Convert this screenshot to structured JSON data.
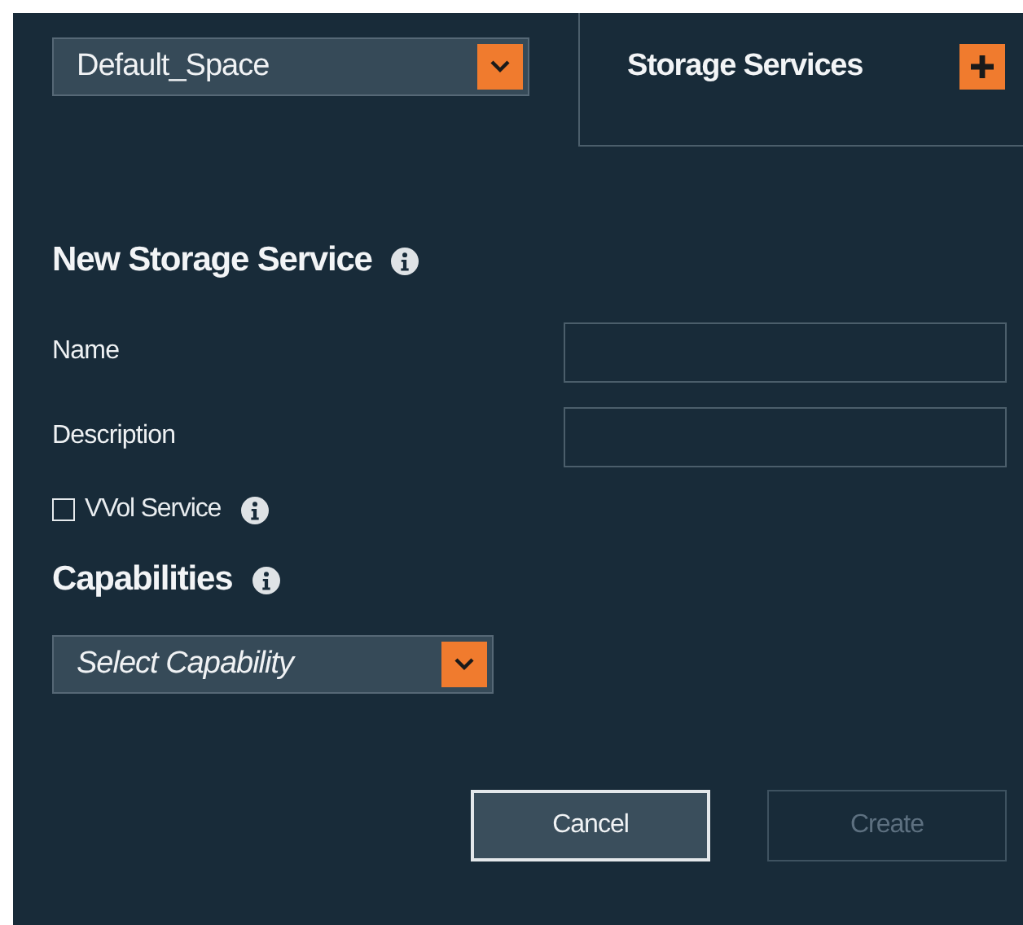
{
  "space_select": {
    "value": "Default_Space"
  },
  "tab": {
    "label": "Storage Services"
  },
  "form": {
    "title": "New Storage Service",
    "fields": [
      {
        "label": "Name"
      },
      {
        "label": "Description"
      }
    ],
    "vvol": {
      "label": "VVol Service",
      "checked": false
    }
  },
  "capabilities": {
    "title": "Capabilities",
    "select": {
      "placeholder": "Select Capability"
    }
  },
  "buttons": [
    {
      "label": "Cancel",
      "disabled": false
    },
    {
      "label": "Create",
      "disabled": true
    }
  ]
}
